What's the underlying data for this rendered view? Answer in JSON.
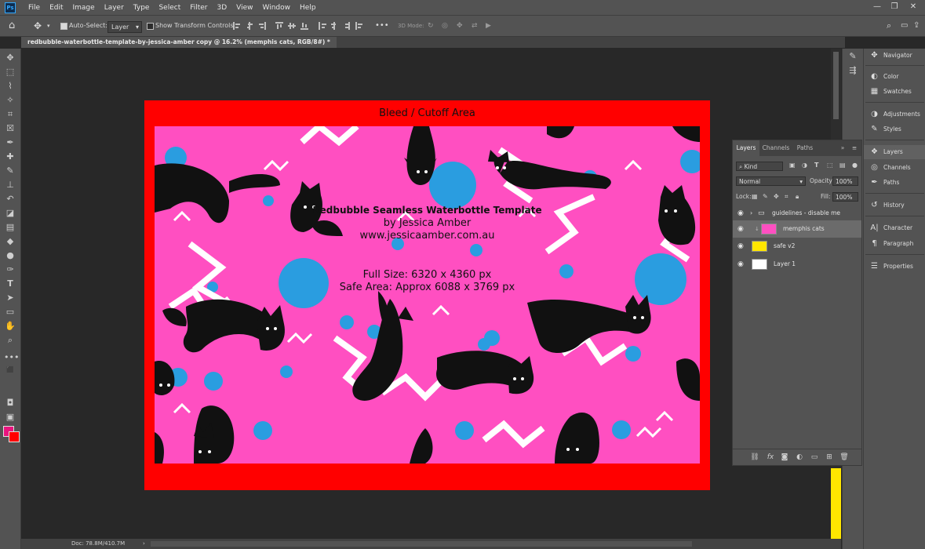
{
  "menubar": {
    "logo": "Ps",
    "items": [
      "File",
      "Edit",
      "Image",
      "Layer",
      "Type",
      "Select",
      "Filter",
      "3D",
      "View",
      "Window",
      "Help"
    ]
  },
  "options": {
    "auto_select_label": "Auto-Select:",
    "auto_select_value": "Layer",
    "transform_label": "Show Transform Controls",
    "mode_3d_label": "3D Mode:",
    "more": "•••"
  },
  "document": {
    "tab_title": "redbubble-waterbottle-template-by-jessica-amber copy @ 16.2% (memphis cats, RGB/8#) *",
    "tab_close": "×",
    "bleed_label": "Bleed / Cutoff Area",
    "template_title": "Redbubble Seamless Waterbottle Template",
    "byline": "by Jessica Amber",
    "website": "www.jessicaamber.com.au",
    "full_size": "Full Size: 6320 x 4360 px",
    "safe_area": "Safe Area: Approx 6088 x 3769 px"
  },
  "status": {
    "doc_info": "Doc: 78.8M/410.7M",
    "arrow": "›"
  },
  "right_panels": [
    {
      "icon": "navigator-icon",
      "glyph": "✥",
      "label": "Navigator"
    },
    {
      "icon": "color-icon",
      "glyph": "◐",
      "label": "Color"
    },
    {
      "icon": "swatches-icon",
      "glyph": "▦",
      "label": "Swatches"
    },
    {
      "icon": "adjustments-icon",
      "glyph": "◑",
      "label": "Adjustments"
    },
    {
      "icon": "styles-icon",
      "glyph": "✎",
      "label": "Styles"
    },
    {
      "icon": "layers-icon",
      "glyph": "❖",
      "label": "Layers"
    },
    {
      "icon": "channels-icon",
      "glyph": "◎",
      "label": "Channels"
    },
    {
      "icon": "paths-icon",
      "glyph": "✒",
      "label": "Paths"
    },
    {
      "icon": "history-icon",
      "glyph": "↺",
      "label": "History"
    },
    {
      "icon": "character-icon",
      "glyph": "A|",
      "label": "Character"
    },
    {
      "icon": "paragraph-icon",
      "glyph": "¶",
      "label": "Paragraph"
    },
    {
      "icon": "properties-icon",
      "glyph": "☰",
      "label": "Properties"
    }
  ],
  "layers_panel": {
    "tabs": [
      "Layers",
      "Channels",
      "Paths"
    ],
    "filter_kind": "Kind",
    "blend_mode": "Normal",
    "opacity_label": "Opacity:",
    "opacity_value": "100%",
    "lock_label": "Lock:",
    "fill_label": "Fill:",
    "fill_value": "100%",
    "layers": [
      {
        "name": "guidelines - disable me",
        "type": "group",
        "thumb": "#000000"
      },
      {
        "name": "memphis cats",
        "type": "layer",
        "thumb": "#ff4fc1"
      },
      {
        "name": "safe v2",
        "type": "layer",
        "thumb": "#ffe600"
      },
      {
        "name": "Layer 1",
        "type": "layer",
        "thumb": "#ffffff"
      }
    ]
  },
  "colors": {
    "foreground": "#e8147e",
    "background": "#ff0000",
    "pattern_pink": "#ff4fc1",
    "pattern_blue": "#2a9de0",
    "bleed_red": "#ff0000",
    "safe_yellow": "#ffe600"
  }
}
